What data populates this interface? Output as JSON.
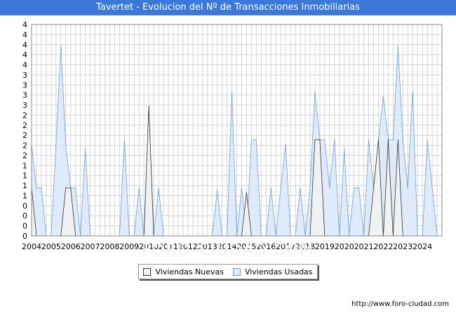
{
  "title": "Tavertet - Evolucion del Nº de Transacciones Inmobiliarias",
  "watermark": "FORO-CIUDAD.COM",
  "footer_url": "http://www.foro-ciudad.com",
  "colors": {
    "title_bg": "#3c78d8",
    "nuevas_fill": "#f2f2f2",
    "nuevas_line": "#333333",
    "usadas_fill": "#dbe9fb",
    "usadas_line": "#6a9fd8"
  },
  "chart_data": {
    "type": "area",
    "title": "Tavertet - Evolucion del Nº de Transacciones Inmobiliarias",
    "xlabel": "",
    "ylabel": "",
    "ylim": [
      0,
      4.4
    ],
    "y_tick_labels": [
      "0",
      "0",
      "0",
      "0",
      "1",
      "1",
      "1",
      "1",
      "2",
      "2",
      "2",
      "2",
      "2",
      "3",
      "3",
      "3",
      "3",
      "4",
      "4",
      "4",
      "4",
      "4"
    ],
    "x_tick_labels": [
      "2004",
      "2005",
      "2006",
      "2007",
      "2008",
      "2009",
      "2010",
      "2011",
      "2012",
      "2013",
      "2014",
      "2015",
      "2016",
      "2017",
      "2018",
      "2019",
      "2020",
      "2021",
      "2022",
      "2023",
      "2024"
    ],
    "x_range": [
      2004.0,
      2025.0
    ],
    "grid": true,
    "legend": "bottom-center",
    "series": [
      {
        "name": "Viviendas Nuevas",
        "points": [
          [
            2004.0,
            1.0
          ],
          [
            2004.25,
            0
          ],
          [
            2004.5,
            0
          ],
          [
            2004.75,
            0
          ],
          [
            2005.0,
            0
          ],
          [
            2005.25,
            0
          ],
          [
            2005.5,
            0
          ],
          [
            2005.75,
            1.0
          ],
          [
            2006.0,
            1.0
          ],
          [
            2006.25,
            0
          ],
          [
            2006.5,
            0
          ],
          [
            2006.75,
            0
          ],
          [
            2007.0,
            0
          ],
          [
            2007.25,
            0
          ],
          [
            2007.5,
            0
          ],
          [
            2007.75,
            0
          ],
          [
            2008.0,
            0
          ],
          [
            2008.25,
            0
          ],
          [
            2008.5,
            0
          ],
          [
            2008.75,
            0
          ],
          [
            2009.0,
            0
          ],
          [
            2009.25,
            0
          ],
          [
            2009.5,
            0
          ],
          [
            2009.75,
            0
          ],
          [
            2010.0,
            2.7
          ],
          [
            2010.25,
            0
          ],
          [
            2010.5,
            0
          ],
          [
            2010.75,
            0
          ],
          [
            2011.0,
            0
          ],
          [
            2011.25,
            0
          ],
          [
            2011.5,
            0
          ],
          [
            2011.75,
            0
          ],
          [
            2012.0,
            0
          ],
          [
            2012.25,
            0
          ],
          [
            2012.5,
            0
          ],
          [
            2012.75,
            0
          ],
          [
            2013.0,
            0
          ],
          [
            2013.25,
            0
          ],
          [
            2013.5,
            0
          ],
          [
            2013.75,
            0
          ],
          [
            2014.0,
            0
          ],
          [
            2014.25,
            0
          ],
          [
            2014.5,
            0
          ],
          [
            2014.75,
            0
          ],
          [
            2015.0,
            0.9
          ],
          [
            2015.25,
            0
          ],
          [
            2015.5,
            0
          ],
          [
            2015.75,
            0
          ],
          [
            2016.0,
            0
          ],
          [
            2016.25,
            0
          ],
          [
            2016.5,
            0
          ],
          [
            2016.75,
            0
          ],
          [
            2017.0,
            0
          ],
          [
            2017.25,
            0
          ],
          [
            2017.5,
            0
          ],
          [
            2017.75,
            0
          ],
          [
            2018.0,
            0
          ],
          [
            2018.25,
            0
          ],
          [
            2018.5,
            2.0
          ],
          [
            2018.75,
            2.0
          ],
          [
            2019.0,
            0
          ],
          [
            2019.25,
            0
          ],
          [
            2019.5,
            0
          ],
          [
            2019.75,
            0
          ],
          [
            2020.0,
            0
          ],
          [
            2020.25,
            0
          ],
          [
            2020.5,
            0
          ],
          [
            2020.75,
            0
          ],
          [
            2021.0,
            0
          ],
          [
            2021.25,
            0
          ],
          [
            2021.5,
            1.0
          ],
          [
            2021.75,
            2.0
          ],
          [
            2022.0,
            0
          ],
          [
            2022.25,
            2.0
          ],
          [
            2022.5,
            0
          ],
          [
            2022.75,
            2.0
          ],
          [
            2023.0,
            0
          ],
          [
            2023.25,
            0
          ],
          [
            2023.5,
            0
          ],
          [
            2023.75,
            0
          ],
          [
            2024.0,
            0
          ],
          [
            2024.25,
            0
          ],
          [
            2024.5,
            0
          ],
          [
            2024.75,
            0
          ]
        ]
      },
      {
        "name": "Viviendas Usadas",
        "points": [
          [
            2004.0,
            1.9
          ],
          [
            2004.25,
            1.0
          ],
          [
            2004.5,
            1.0
          ],
          [
            2004.75,
            0
          ],
          [
            2005.0,
            0
          ],
          [
            2005.25,
            1.9
          ],
          [
            2005.5,
            3.95
          ],
          [
            2005.75,
            1.9
          ],
          [
            2006.0,
            1.0
          ],
          [
            2006.25,
            1.0
          ],
          [
            2006.5,
            0
          ],
          [
            2006.75,
            1.8
          ],
          [
            2007.0,
            0
          ],
          [
            2007.25,
            0
          ],
          [
            2007.5,
            0
          ],
          [
            2007.75,
            0
          ],
          [
            2008.0,
            0
          ],
          [
            2008.25,
            0
          ],
          [
            2008.5,
            0
          ],
          [
            2008.75,
            2.0
          ],
          [
            2009.0,
            0
          ],
          [
            2009.25,
            0
          ],
          [
            2009.5,
            1.0
          ],
          [
            2009.75,
            0
          ],
          [
            2010.0,
            2.7
          ],
          [
            2010.25,
            0
          ],
          [
            2010.5,
            1.0
          ],
          [
            2010.75,
            0
          ],
          [
            2011.0,
            0
          ],
          [
            2011.25,
            0
          ],
          [
            2011.5,
            0
          ],
          [
            2011.75,
            0
          ],
          [
            2012.0,
            0
          ],
          [
            2012.25,
            0
          ],
          [
            2012.5,
            0
          ],
          [
            2012.75,
            0
          ],
          [
            2013.0,
            0
          ],
          [
            2013.25,
            0
          ],
          [
            2013.5,
            0.95
          ],
          [
            2013.75,
            0
          ],
          [
            2014.0,
            0
          ],
          [
            2014.25,
            3.0
          ],
          [
            2014.5,
            0
          ],
          [
            2014.75,
            1.0
          ],
          [
            2015.0,
            0
          ],
          [
            2015.25,
            2.0
          ],
          [
            2015.5,
            2.0
          ],
          [
            2015.75,
            0
          ],
          [
            2016.0,
            0
          ],
          [
            2016.25,
            1.0
          ],
          [
            2016.5,
            0
          ],
          [
            2016.75,
            1.0
          ],
          [
            2017.0,
            1.9
          ],
          [
            2017.25,
            0
          ],
          [
            2017.5,
            0
          ],
          [
            2017.75,
            1.0
          ],
          [
            2018.0,
            0
          ],
          [
            2018.25,
            1.0
          ],
          [
            2018.5,
            3.0
          ],
          [
            2018.75,
            2.0
          ],
          [
            2019.0,
            2.0
          ],
          [
            2019.25,
            1.0
          ],
          [
            2019.5,
            2.0
          ],
          [
            2019.75,
            0
          ],
          [
            2020.0,
            1.8
          ],
          [
            2020.25,
            0
          ],
          [
            2020.5,
            1.0
          ],
          [
            2020.75,
            1.0
          ],
          [
            2021.0,
            0
          ],
          [
            2021.25,
            2.0
          ],
          [
            2021.5,
            1.0
          ],
          [
            2021.75,
            2.0
          ],
          [
            2022.0,
            2.9
          ],
          [
            2022.25,
            2.0
          ],
          [
            2022.5,
            2.0
          ],
          [
            2022.75,
            3.95
          ],
          [
            2023.0,
            2.0
          ],
          [
            2023.25,
            1.0
          ],
          [
            2023.5,
            3.0
          ],
          [
            2023.75,
            0
          ],
          [
            2024.0,
            0
          ],
          [
            2024.25,
            2.0
          ],
          [
            2024.5,
            1.0
          ],
          [
            2024.75,
            0
          ]
        ]
      }
    ]
  }
}
